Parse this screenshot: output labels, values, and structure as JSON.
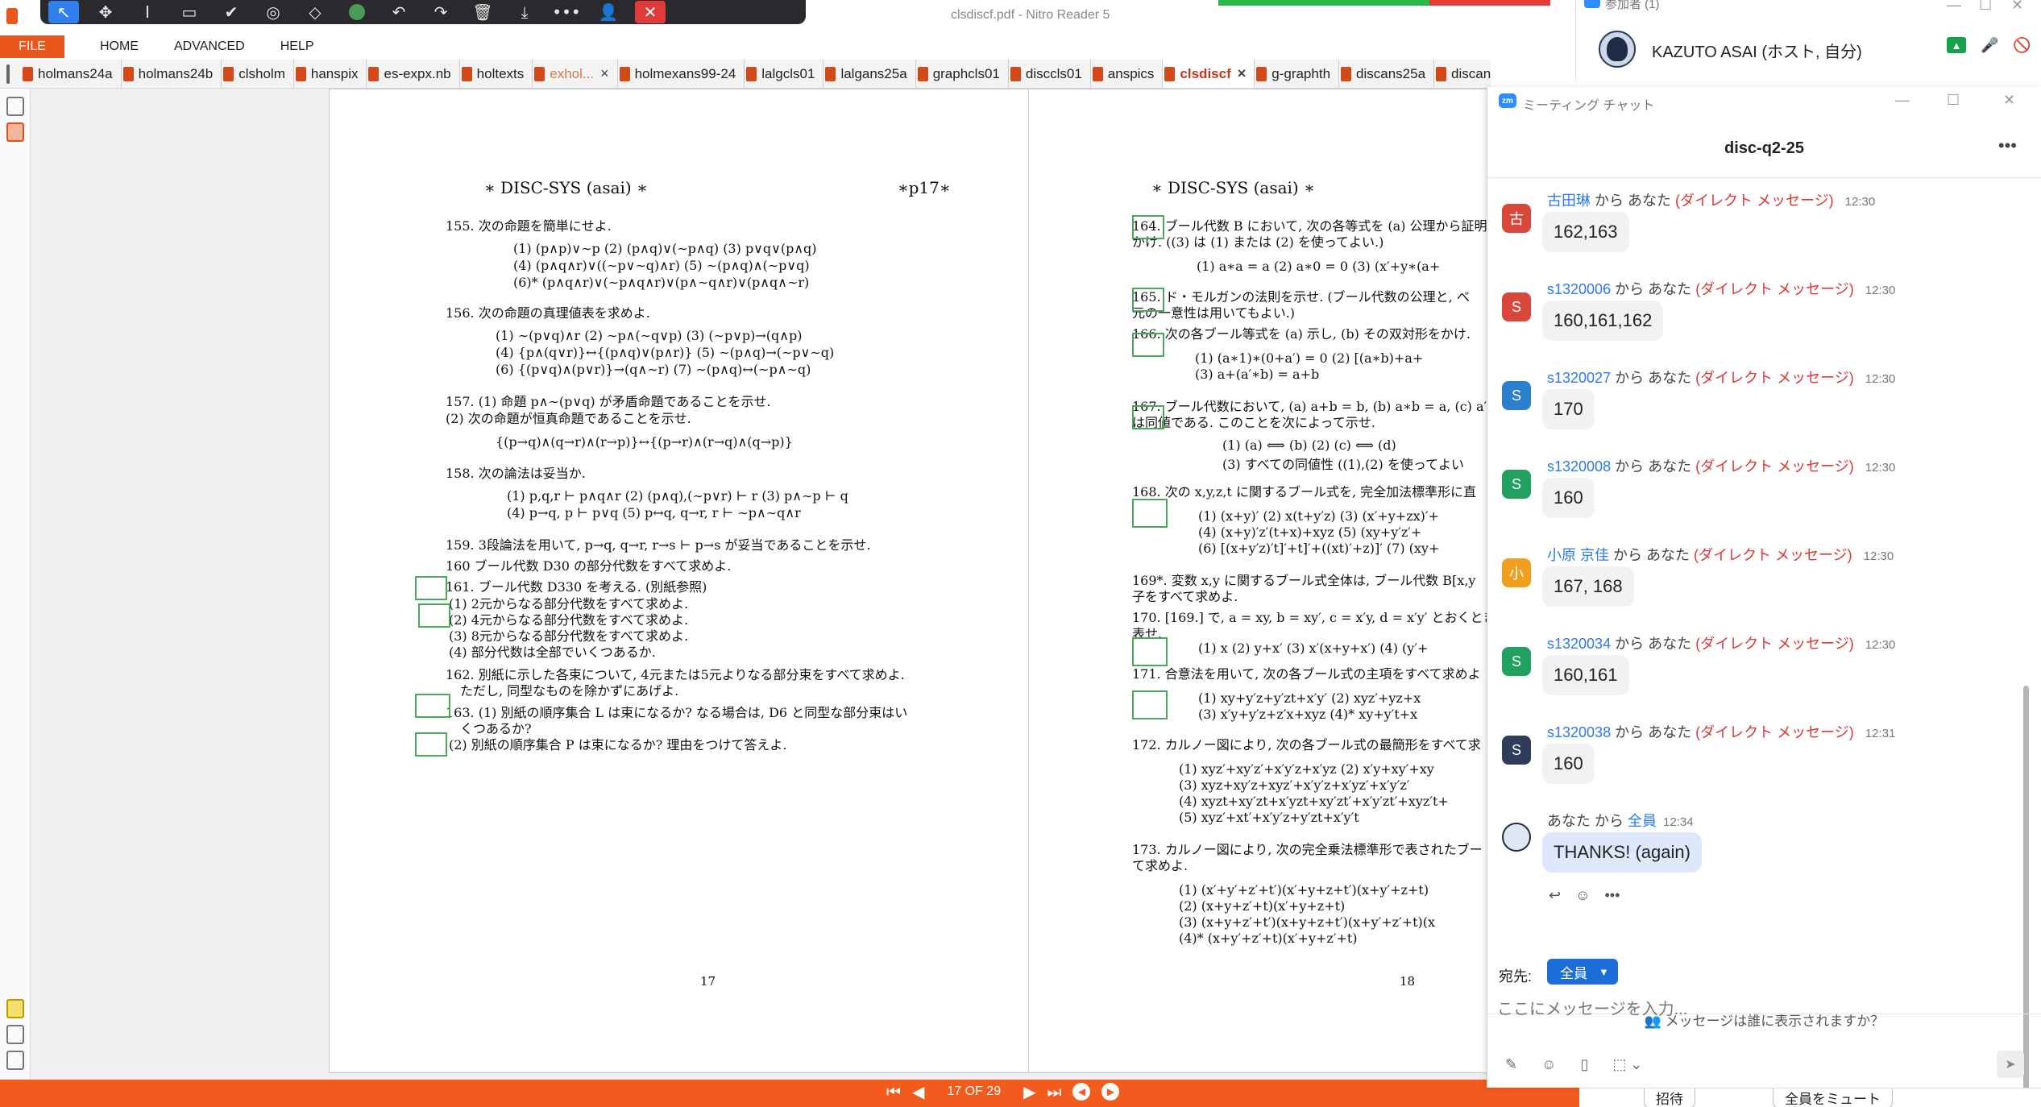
{
  "window": {
    "title": "clsdiscf.pdf - Nitro Reader 5"
  },
  "floating_toolbar": {
    "icons": [
      "select-arrow-icon",
      "pan-icon",
      "text-cursor-icon",
      "rectangle-icon",
      "check-icon",
      "stamp-icon",
      "eraser-icon",
      "color-dot-icon",
      "undo-icon",
      "redo-icon",
      "trash-icon",
      "download-icon",
      "more-icon",
      "user-icon",
      "close-icon"
    ],
    "glyphs": {
      "select": "↖",
      "pan": "✥",
      "text": "I",
      "rect": "▭",
      "check": "✔",
      "stamp": "◎",
      "eraser": "◇",
      "undo": "↶",
      "redo": "↷",
      "trash": "🗑",
      "download": "⤓",
      "more": "•••",
      "user": "👤",
      "close": "✕"
    }
  },
  "menu": {
    "file": "FILE",
    "items": [
      "HOME",
      "ADVANCED",
      "HELP"
    ]
  },
  "tabs": [
    {
      "label": "holmans24a"
    },
    {
      "label": "holmans24b"
    },
    {
      "label": "clsholm"
    },
    {
      "label": "hanspix"
    },
    {
      "label": "es-expx.nb"
    },
    {
      "label": "holtexts"
    },
    {
      "label": "exhol...",
      "close": "×"
    },
    {
      "label": "holmexans99-24"
    },
    {
      "label": "lalgcls01"
    },
    {
      "label": "lalgans25a"
    },
    {
      "label": "graphcls01"
    },
    {
      "label": "disccls01"
    },
    {
      "label": "anspics"
    },
    {
      "label": "clsdiscf",
      "close": "×"
    },
    {
      "label": "g-graphth"
    },
    {
      "label": "discans25a"
    },
    {
      "label": "discans"
    }
  ],
  "page17": {
    "header_left": "∗ DISC-SYS (asai) ∗",
    "header_right": "∗p17∗",
    "lines": [
      "155. 次の命題を簡単にせよ.",
      "(1) (p∧p)∨∼p   (2) (p∧q)∨(∼p∧q)   (3) p∨q∨(p∧q)",
      "(4) (p∧q∧r)∨((∼p∨∼q)∧r)   (5) ∼(p∧q)∧(∼p∨q)",
      "(6)* (p∧q∧r)∨(∼p∧q∧r)∨(p∧∼q∧r)∨(p∧q∧∼r)",
      "156. 次の命題の真理値表を求めよ.",
      "(1) ∼(p∨q)∧r   (2) ∼p∧(∼q∨p)   (3) (∼p∨p)→(q∧p)",
      "(4) {p∧(q∨r)}↔{(p∧q)∨(p∧r)}   (5) ∼(p∧q)→(∼p∨∼q)",
      "(6) {(p∨q)∧(p∨r)}→(q∧∼r)   (7) ∼(p∧q)↔(∼p∧∼q)",
      "157. (1) 命題 p∧∼(p∨q) が矛盾命題であることを示せ.",
      "(2) 次の命題が恒真命題であることを示せ.",
      "{(p→q)∧(q→r)∧(r→p)}↔{(p→r)∧(r→q)∧(q→p)}",
      "158. 次の論法は妥当か.",
      "(1) p,q,r ⊢ p∧q∧r   (2) (p∧q),(∼p∨r) ⊢ r   (3) p∧∼p ⊢ q",
      "(4) p→q, p ⊢ p∨q       (5) p↔q, q→r, r ⊢ ∼p∧∼q∧r",
      "159. 3段論法を用いて, p→q, q→r, r→s ⊢ p→s が妥当であることを示せ.",
      "160 ブール代数 D30 の部分代数をすべて求めよ.",
      "161. ブール代数 D330 を考える. (別紙参照)",
      "(1) 2元からなる部分代数をすべて求めよ.",
      "(2) 4元からなる部分代数をすべて求めよ.",
      "(3) 8元からなる部分代数をすべて求めよ.",
      "(4) 部分代数は全部でいくつあるか.",
      "162. 別紙に示した各束について, 4元または5元よりなる部分束をすべて求めよ.",
      "ただし, 同型なものを除かずにあげよ.",
      "163. (1) 別紙の順序集合 L は束になるか? なる場合は, D6 と同型な部分束はい",
      "くつあるか?",
      "(2) 別紙の順序集合 P は束になるか? 理由をつけて答えよ."
    ],
    "page_number": "17"
  },
  "page18": {
    "header_left": "∗ DISC-SYS (asai) ∗",
    "lines": [
      "164. ブール代数 B において, 次の各等式を (a) 公理から証明",
      "かけ. ((3) は (1) または (2) を使ってよい.)",
      "(1) a∗a = a      (2) a∗0 = 0      (3) (x′+y∗(a+",
      "165. ド・モルガンの法則を示せ. (ブール代数の公理と, べ",
      "元の一意性は用いてもよい.)",
      "166. 次の各ブール等式を (a) 示し, (b) その双対形をかけ.",
      "(1) (a∗1)∗(0+a′) = 0      (2) [(a∗b)+a+",
      "(3) a+(a′∗b) = a+b",
      "167. ブール代数において, (a) a+b = b, (b) a∗b = a, (c) a′",
      "は同値である. このことを次によって示せ.",
      "(1) (a) ⟺ (b)      (2) (c) ⟺ (d)",
      "(3) すべての同値性 ((1),(2) を使ってよい",
      "168. 次の x,y,z,t に関するブール式を, 完全加法標準形に直",
      "(1) (x+y)′   (2) x(t+y′z)   (3) (x′+y+zx)′+",
      "(4) (x+y)′z′(t+x)+xyz     (5) (xy+y′z′+",
      "(6) [(x+y′z)′t]′+t]′+((xt)′+z)]′       (7) (xy+",
      "169*. 変数 x,y に関するブール式全体は, ブール代数 B[x,y",
      "子をすべて求めよ.",
      "170. [169.] で, a = xy, b = xy′, c = x′y, d = x′y′ とおくとき",
      "表せ.",
      "(1) x    (2) y+x′    (3) x′(x+y+x′)    (4) (y′+",
      "171. 合意法を用いて, 次の各ブール式の主項をすべて求めよ",
      "(1) xy+y′z+y′zt+x′y′        (2) xyz′+yz+x",
      "(3) x′y+y′z+z′x+xyz           (4)* xy+y′t+x",
      "172. カルノー図により, 次の各ブール式の最簡形をすべて求",
      "(1) xyz′+xy′z′+x′y′z+x′yz        (2) x′y+xy′+xy",
      "(3) xyz+xy′z+xyz′+x′y′z+x′yz′+x′y′z′",
      "(4) xyzt+xy′zt+x′yzt+xy′zt′+x′y′zt′+xyz′t+",
      "(5) xyz′+xt′+x′y′z+y′zt+x′y′t",
      "173. カルノー図により, 次の完全乗法標準形で表されたブー",
      "て求めよ.",
      "(1) (x′+y′+z′+t′)(x′+y+z+t′)(x+y′+z+t)",
      "(2) (x+y+z′+t)(x′+y+z+t)",
      "(3) (x+y+z′+t′)(x+y+z+t′)(x+y′+z′+t)(x",
      "(4)* (x+y′+z′+t)(x′+y+z′+t)"
    ],
    "page_number": "18"
  },
  "bottom_nav": {
    "first": "⏮",
    "prev": "◀",
    "page_indicator": "17 OF 29",
    "next": "▶",
    "last": "⏭",
    "back": "◀",
    "forward": "▶"
  },
  "zoom_participants": {
    "header": "参加者 (1)",
    "participant_name": "KAZUTO ASAI (ホスト, 自分)",
    "share_glyph": "▲",
    "mic_glyph": "🎤",
    "cam_glyph": "🚫"
  },
  "chat": {
    "window_title": "ミーティング チャット",
    "zm_badge": "zm",
    "meeting_name": "disc-q2-25",
    "more": "•••",
    "messages": [
      {
        "avatar": "古",
        "avatar_color": "#d9463a",
        "sender": "古田琳",
        "to": " から あなた",
        "dm": "(ダイレクト メッセージ)",
        "time": "12:30",
        "text": "162,163"
      },
      {
        "avatar": "S",
        "avatar_color": "#d9463a",
        "sender": "s1320006",
        "to": " から あなた",
        "dm": "(ダイレクト メッセージ)",
        "time": "12:30",
        "text": "160,161,162"
      },
      {
        "avatar": "S",
        "avatar_color": "#2c7fce",
        "sender": "s1320027",
        "to": " から あなた",
        "dm": "(ダイレクト メッセージ)",
        "time": "12:30",
        "text": "170"
      },
      {
        "avatar": "S",
        "avatar_color": "#22a060",
        "sender": "s1320008",
        "to": " から あなた",
        "dm": "(ダイレクト メッセージ)",
        "time": "12:30",
        "text": "160"
      },
      {
        "avatar": "小",
        "avatar_color": "#f0a020",
        "sender": "小原 京佳",
        "to": " から あなた",
        "dm": "(ダイレクト メッセージ)",
        "time": "12:30",
        "text": "167, 168"
      },
      {
        "avatar": "S",
        "avatar_color": "#22a060",
        "sender": "s1320034",
        "to": " から あなた",
        "dm": "(ダイレクト メッセージ)",
        "time": "12:30",
        "text": "160,161"
      },
      {
        "avatar": "S",
        "avatar_color": "#2e3e5a",
        "sender": "s1320038",
        "to": " から あなた",
        "dm": "(ダイレクト メッセージ)",
        "time": "12:31",
        "text": "160"
      }
    ],
    "self_message": {
      "from": "あなた から ",
      "to": "全員",
      "time": "12:34",
      "text": "THANKS! (again)"
    },
    "visibility_note": "メッセージは誰に表示されますか？",
    "to_label": "宛先:",
    "to_value": "全員",
    "input_placeholder": "ここにメッセージを入力..."
  },
  "zoom_footer": {
    "invite": "招待",
    "mute_all": "全員をミュート"
  }
}
